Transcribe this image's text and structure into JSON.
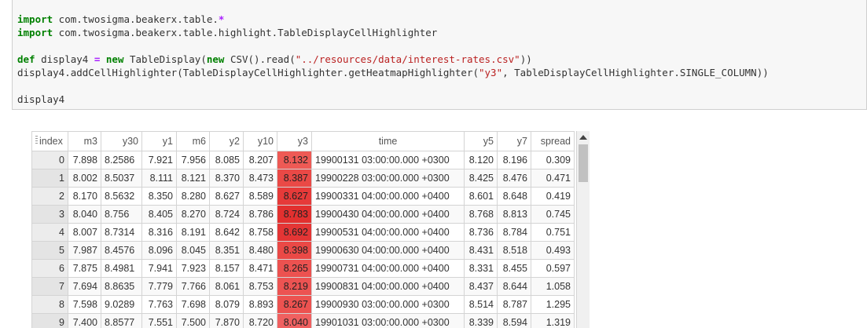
{
  "code_cell": {
    "lines": [
      [
        {
          "t": "import",
          "c": "kw"
        },
        {
          "t": " com.twosigma.beakerx.table."
        },
        {
          "t": "*",
          "c": "op"
        }
      ],
      [
        {
          "t": "import",
          "c": "kw"
        },
        {
          "t": " com.twosigma.beakerx.table.highlight.TableDisplayCellHighlighter"
        }
      ],
      [
        {
          "t": ""
        }
      ],
      [
        {
          "t": "def",
          "c": "kw"
        },
        {
          "t": " display4 "
        },
        {
          "t": "=",
          "c": "op"
        },
        {
          "t": " "
        },
        {
          "t": "new",
          "c": "kw"
        },
        {
          "t": " TableDisplay("
        },
        {
          "t": "new",
          "c": "kw"
        },
        {
          "t": " CSV().read("
        },
        {
          "t": "\"../resources/data/interest-rates.csv\"",
          "c": "str"
        },
        {
          "t": "))"
        }
      ],
      [
        {
          "t": "display4.addCellHighlighter(TableDisplayCellHighlighter.getHeatmapHighlighter("
        },
        {
          "t": "\"y3\"",
          "c": "str"
        },
        {
          "t": ", TableDisplayCellHighlighter.SINGLE_COLUMN))"
        }
      ],
      [
        {
          "t": ""
        }
      ],
      [
        {
          "t": "display4"
        }
      ]
    ]
  },
  "table": {
    "columns": [
      "index",
      "m3",
      "y30",
      "y1",
      "m6",
      "y2",
      "y10",
      "y3",
      "time",
      "y5",
      "y7",
      "spread"
    ],
    "highlight_column": "y3",
    "highlight_colors": {
      "8.132": "#ee5a55",
      "8.387": "#ea4946",
      "8.627": "#e63a39",
      "8.783": "#e2302f",
      "8.692": "#e43535",
      "8.398": "#ea4946",
      "8.265": "#ec5250",
      "8.219": "#ec5352",
      "8.267": "#ec5250",
      "8.040": "#f06060"
    },
    "rows": [
      [
        "0",
        "7.898",
        "8.2586",
        "7.921",
        "7.956",
        "8.085",
        "8.207",
        "8.132",
        "19900131 03:00:00.000 +0300",
        "8.120",
        "8.196",
        "0.309"
      ],
      [
        "1",
        "8.002",
        "8.5037",
        "8.111",
        "8.121",
        "8.370",
        "8.473",
        "8.387",
        "19900228 03:00:00.000 +0300",
        "8.425",
        "8.476",
        "0.471"
      ],
      [
        "2",
        "8.170",
        "8.5632",
        "8.350",
        "8.280",
        "8.627",
        "8.589",
        "8.627",
        "19900331 04:00:00.000 +0400",
        "8.601",
        "8.648",
        "0.419"
      ],
      [
        "3",
        "8.040",
        "8.756",
        "8.405",
        "8.270",
        "8.724",
        "8.786",
        "8.783",
        "19900430 04:00:00.000 +0400",
        "8.768",
        "8.813",
        "0.745"
      ],
      [
        "4",
        "8.007",
        "8.7314",
        "8.316",
        "8.191",
        "8.642",
        "8.758",
        "8.692",
        "19900531 04:00:00.000 +0400",
        "8.736",
        "8.784",
        "0.751"
      ],
      [
        "5",
        "7.987",
        "8.4576",
        "8.096",
        "8.045",
        "8.351",
        "8.480",
        "8.398",
        "19900630 04:00:00.000 +0400",
        "8.431",
        "8.518",
        "0.493"
      ],
      [
        "6",
        "7.875",
        "8.4981",
        "7.941",
        "7.923",
        "8.157",
        "8.471",
        "8.265",
        "19900731 04:00:00.000 +0400",
        "8.331",
        "8.455",
        "0.597"
      ],
      [
        "7",
        "7.694",
        "8.8635",
        "7.779",
        "7.766",
        "8.061",
        "8.753",
        "8.219",
        "19900831 04:00:00.000 +0400",
        "8.437",
        "8.644",
        "1.058"
      ],
      [
        "8",
        "7.598",
        "9.0289",
        "7.763",
        "7.698",
        "8.079",
        "8.893",
        "8.267",
        "19900930 03:00:00.000 +0300",
        "8.514",
        "8.787",
        "1.295"
      ],
      [
        "9",
        "7.400",
        "8.8577",
        "7.551",
        "7.500",
        "7.870",
        "8.720",
        "8.040",
        "19901031 03:00:00.000 +0300",
        "8.339",
        "8.594",
        "1.319"
      ]
    ]
  }
}
